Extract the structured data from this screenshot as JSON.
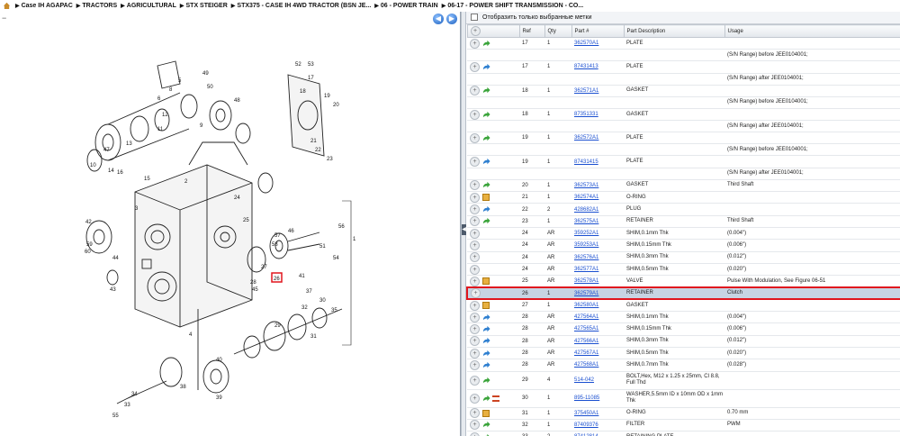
{
  "breadcrumb": [
    "Case IH AGAPAC",
    "TRACTORS",
    "AGRICULTURAL",
    "STX STEIGER",
    "STX375 - CASE IH 4WD TRACTOR (BSN JE...",
    "06 - POWER TRAIN",
    "06-17 - POWER SHIFT TRANSMISSION - CO..."
  ],
  "filter": {
    "label": "Отобразить только выбранные метки"
  },
  "columns": [
    "Ref",
    "Qty",
    "Part #",
    "Part Description",
    "Usage"
  ],
  "diagram_labels": [
    "1",
    "2",
    "3",
    "4",
    "5",
    "6",
    "7",
    "8",
    "9",
    "10",
    "11",
    "12",
    "13",
    "14",
    "15",
    "16",
    "17",
    "18",
    "19",
    "20",
    "21",
    "22",
    "23",
    "24",
    "25",
    "26",
    "27",
    "28",
    "29",
    "30",
    "31",
    "32",
    "33",
    "34",
    "35",
    "36",
    "37",
    "38",
    "39",
    "40",
    "41",
    "42",
    "43",
    "44",
    "45",
    "46",
    "47",
    "48",
    "49",
    "50",
    "51",
    "52",
    "53",
    "54",
    "55",
    "56",
    "57",
    "58",
    "59",
    "60"
  ],
  "selected_ref": "26",
  "rows": [
    {
      "icon": "green-arrow",
      "ref": "17",
      "qty": "1",
      "part": "362570A1",
      "desc": "PLATE",
      "usage": "(S/N Range) before JEE0104001;",
      "usage_row": true
    },
    {
      "icon": "blue-arrow",
      "ref": "17",
      "qty": "1",
      "part": "87431413",
      "desc": "PLATE",
      "usage": "(S/N Range) after JEE0104001;",
      "usage_row": true
    },
    {
      "icon": "green-arrow",
      "ref": "18",
      "qty": "1",
      "part": "362571A1",
      "desc": "GASKET",
      "usage": "(S/N Range) before JEE0104001;",
      "usage_row": true
    },
    {
      "icon": "green-arrow",
      "ref": "18",
      "qty": "1",
      "part": "87351331",
      "desc": "GASKET",
      "usage": "(S/N Range) after JEE0104001;",
      "usage_row": true
    },
    {
      "icon": "green-arrow",
      "ref": "19",
      "qty": "1",
      "part": "362572A1",
      "desc": "PLATE",
      "usage": "(S/N Range) before JEE0104001;",
      "usage_row": true
    },
    {
      "icon": "blue-arrow",
      "ref": "19",
      "qty": "1",
      "part": "87431415",
      "desc": "PLATE",
      "usage": "(S/N Range) after JEE0104001;",
      "usage_row": true
    },
    {
      "icon": "green-arrow",
      "ref": "20",
      "qty": "1",
      "part": "362573A1",
      "desc": "GASKET",
      "usage": "Third Shaft"
    },
    {
      "icon": "box",
      "ref": "21",
      "qty": "1",
      "part": "362574A1",
      "desc": "O-RING",
      "usage": ""
    },
    {
      "icon": "blue-arrow",
      "ref": "22",
      "qty": "2",
      "part": "428682A1",
      "desc": "PLUG",
      "usage": ""
    },
    {
      "icon": "green-arrow",
      "ref": "23",
      "qty": "1",
      "part": "362575A1",
      "desc": "RETAINER",
      "usage": "Third Shaft"
    },
    {
      "icon": "none",
      "ref": "24",
      "qty": "AR",
      "part": "359252A1",
      "desc": "SHIM,0.1mm Thk",
      "usage": "(0.004\")"
    },
    {
      "icon": "none",
      "ref": "24",
      "qty": "AR",
      "part": "359253A1",
      "desc": "SHIM,0.15mm Thk",
      "usage": "(0.006\")"
    },
    {
      "icon": "none",
      "ref": "24",
      "qty": "AR",
      "part": "362576A1",
      "desc": "SHIM,0.3mm Thk",
      "usage": "(0.012\")"
    },
    {
      "icon": "none",
      "ref": "24",
      "qty": "AR",
      "part": "362577A1",
      "desc": "SHIM,0.5mm Thk",
      "usage": "(0.020\")"
    },
    {
      "icon": "box",
      "ref": "25",
      "qty": "AR",
      "part": "362578A1",
      "desc": "VALVE",
      "usage": "Pulse With Modulation, See Figure 06-51"
    },
    {
      "icon": "none",
      "ref": "26",
      "qty": "1",
      "part": "362579A1",
      "desc": "RETAINER",
      "usage": "Clutch",
      "selected": true
    },
    {
      "icon": "box",
      "ref": "27",
      "qty": "1",
      "part": "362580A1",
      "desc": "GASKET",
      "usage": ""
    },
    {
      "icon": "blue-arrow",
      "ref": "28",
      "qty": "AR",
      "part": "427564A1",
      "desc": "SHIM,0.1mm Thk",
      "usage": "(0.004\")"
    },
    {
      "icon": "blue-arrow",
      "ref": "28",
      "qty": "AR",
      "part": "427565A1",
      "desc": "SHIM,0.15mm Thk",
      "usage": "(0.006\")"
    },
    {
      "icon": "blue-arrow",
      "ref": "28",
      "qty": "AR",
      "part": "427566A1",
      "desc": "SHIM,0.3mm Thk",
      "usage": "(0.012\")"
    },
    {
      "icon": "blue-arrow",
      "ref": "28",
      "qty": "AR",
      "part": "427567A1",
      "desc": "SHIM,0.5mm Thk",
      "usage": "(0.020\")"
    },
    {
      "icon": "blue-arrow",
      "ref": "28",
      "qty": "AR",
      "part": "427568A1",
      "desc": "SHIM,0.7mm Thk",
      "usage": "(0.028\")"
    },
    {
      "icon": "green-arrow",
      "ref": "29",
      "qty": "4",
      "part": "514-042",
      "desc": "BOLT,Hex, M12 x 1.25 x 25mm, Cl 8.8, Full Thd",
      "usage": "",
      "tall": true
    },
    {
      "icon": "green-list",
      "ref": "30",
      "qty": "1",
      "part": "895-11085",
      "desc": "WASHER,5.5mm ID x 10mm OD x 1mm Thk",
      "usage": "",
      "tall": true
    },
    {
      "icon": "box",
      "ref": "31",
      "qty": "1",
      "part": "375450A1",
      "desc": "O-RING",
      "usage": "0.70 mm"
    },
    {
      "icon": "green-arrow",
      "ref": "32",
      "qty": "1",
      "part": "87409376",
      "desc": "FILTER",
      "usage": "PWM"
    },
    {
      "icon": "green-arrow",
      "ref": "33",
      "qty": "2",
      "part": "87412814",
      "desc": "RETAINING PLATE",
      "usage": ""
    }
  ]
}
